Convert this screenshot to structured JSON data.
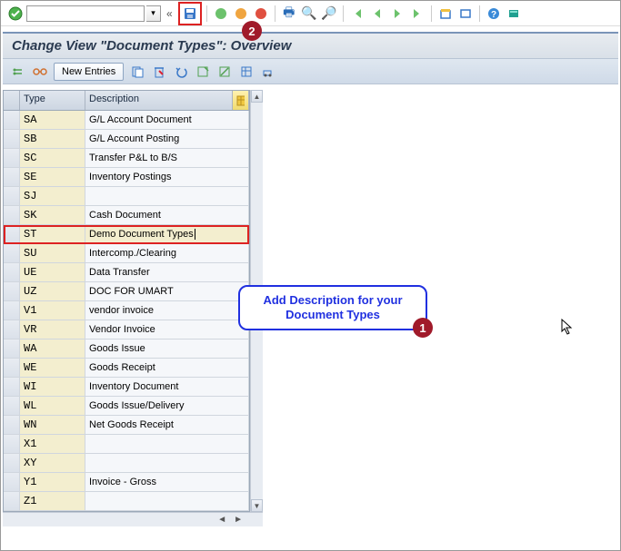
{
  "toolbar": {
    "tcode_value": ""
  },
  "header": {
    "title": "Change View \"Document Types\": Overview"
  },
  "appbar": {
    "new_entries_label": "New Entries"
  },
  "grid": {
    "col_type": "Type",
    "col_desc": "Description",
    "rows": [
      {
        "type": "SA",
        "desc": "G/L Account Document"
      },
      {
        "type": "SB",
        "desc": "G/L Account Posting"
      },
      {
        "type": "SC",
        "desc": "Transfer P&L to B/S"
      },
      {
        "type": "SE",
        "desc": "Inventory Postings"
      },
      {
        "type": "SJ",
        "desc": ""
      },
      {
        "type": "SK",
        "desc": "Cash Document"
      },
      {
        "type": "ST",
        "desc": "Demo Document Types"
      },
      {
        "type": "SU",
        "desc": "Intercomp./Clearing"
      },
      {
        "type": "UE",
        "desc": "Data Transfer"
      },
      {
        "type": "UZ",
        "desc": "DOC FOR UMART"
      },
      {
        "type": "V1",
        "desc": "vendor invoice"
      },
      {
        "type": "VR",
        "desc": "Vendor Invoice"
      },
      {
        "type": "WA",
        "desc": "Goods Issue"
      },
      {
        "type": "WE",
        "desc": "Goods Receipt"
      },
      {
        "type": "WI",
        "desc": "Inventory Document"
      },
      {
        "type": "WL",
        "desc": "Goods Issue/Delivery"
      },
      {
        "type": "WN",
        "desc": "Net Goods Receipt"
      },
      {
        "type": "X1",
        "desc": ""
      },
      {
        "type": "XY",
        "desc": ""
      },
      {
        "type": "Y1",
        "desc": "Invoice - Gross"
      },
      {
        "type": "Z1",
        "desc": ""
      }
    ],
    "highlight_index": 6
  },
  "callout": {
    "text": "Add Description for your Document Types"
  },
  "badges": {
    "one": "1",
    "two": "2"
  },
  "scroll": {
    "left": "◄",
    "right": "►",
    "up": "▲",
    "down": "▼"
  }
}
